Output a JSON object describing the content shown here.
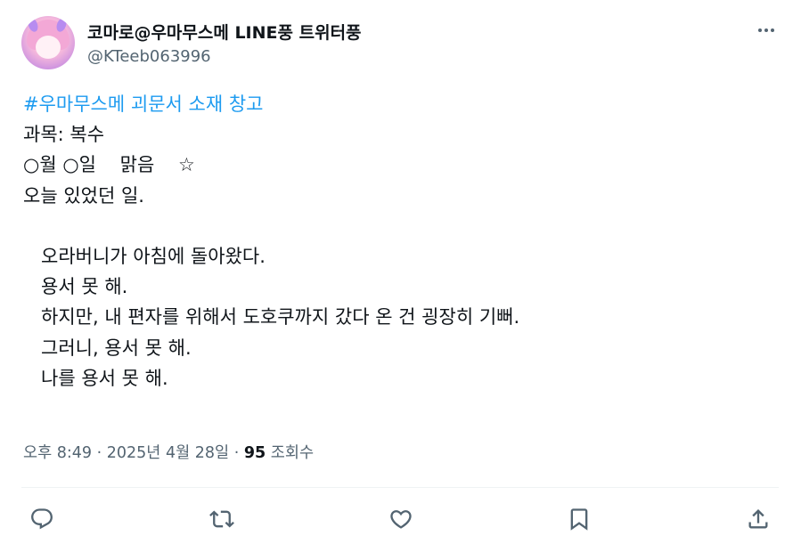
{
  "author": {
    "display_name": "코마로@우마무스메 LINE풍 트위터풍",
    "handle": "@KTeeb063996"
  },
  "tweet": {
    "hashtag": "#우마무스메 괴문서 소재 창고",
    "lines": [
      "과목: 복수",
      "○월 ○일    맑음    ☆",
      "오늘 있었던 일.",
      "",
      "   오라버니가 아침에 돌아왔다.",
      "   용서 못 해.",
      "   하지만, 내 편자를 위해서 도호쿠까지 갔다 온 건 굉장히 기뻐.",
      "   그러니, 용서 못 해.",
      "   나를 용서 못 해."
    ]
  },
  "meta": {
    "time": "오후 8:49",
    "separator1": " · ",
    "date": "2025년 4월 28일",
    "separator2": " · ",
    "views_count": "95",
    "views_label": " 조회수"
  },
  "icons": {
    "more": "more-horizontal-icon",
    "reply": "reply-icon",
    "retweet": "retweet-icon",
    "like": "like-icon",
    "bookmark": "bookmark-icon",
    "share": "share-icon"
  },
  "colors": {
    "hashtag": "#1d9bf0",
    "text": "#0f1419",
    "secondary": "#536471"
  }
}
